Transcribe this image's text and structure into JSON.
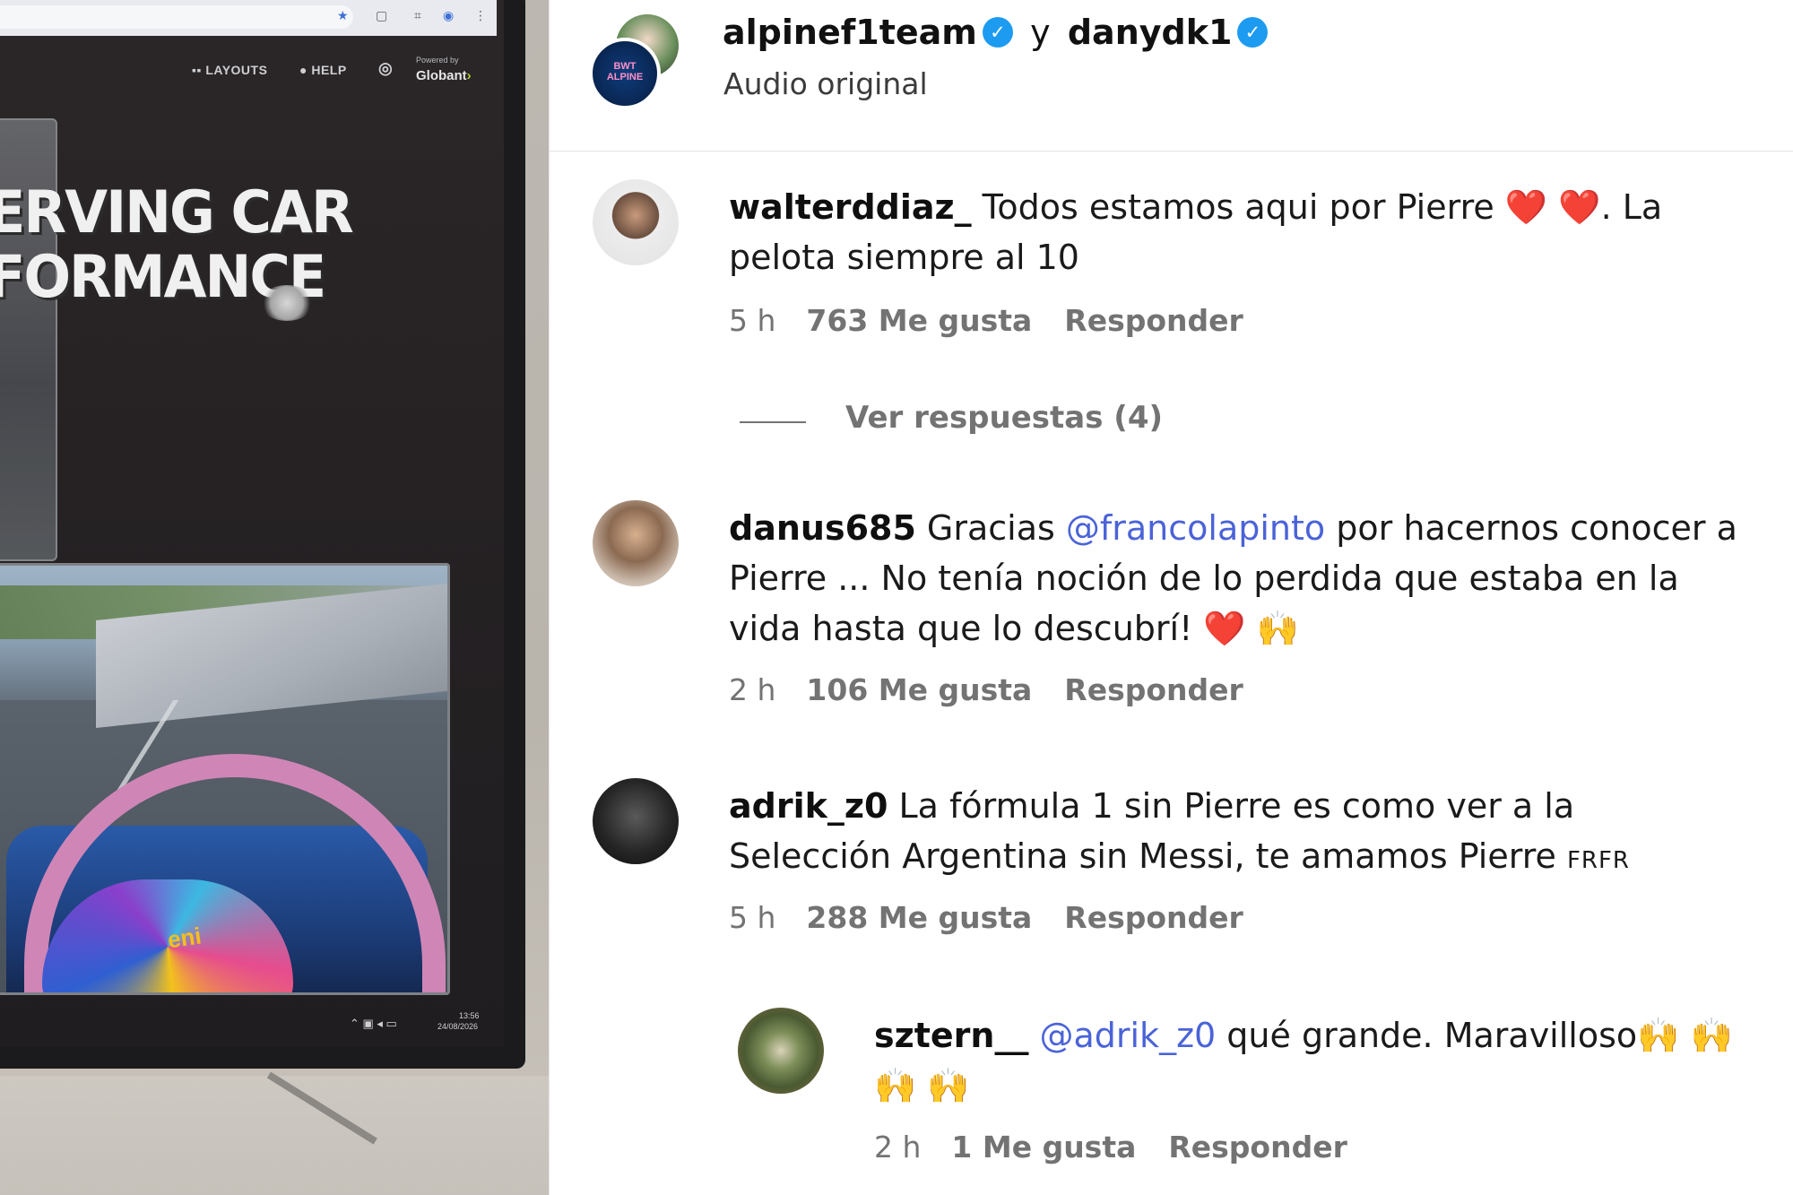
{
  "video": {
    "browser_icons": [
      "star-icon",
      "page-icon",
      "extension-icon",
      "profile-icon",
      "menu-icon"
    ],
    "nav": {
      "layouts": "LAYOUTS",
      "help": "HELP",
      "powered_by": "Powered by",
      "brand": "Globant"
    },
    "headline_line1": "ERVING CAR",
    "headline_line2": "FORMANCE",
    "onboard_logo": "eni",
    "taskbar_time": "13:56",
    "taskbar_date": "24/08/2026"
  },
  "header": {
    "user1": "alpinef1team",
    "joiner": "y",
    "user2": "danydk1",
    "audio_label": "Audio original"
  },
  "comments": [
    {
      "user": "walterddiaz_",
      "text_before": "Todos estamos aqui por Pierre",
      "text_after": ". La pelota siempre al 10",
      "emoji": "❤️ ❤️",
      "time": "5 h",
      "likes": "763 Me gusta",
      "reply": "Responder"
    },
    {
      "user": "danus685",
      "text_before": "Gracias",
      "mention": "@francolapinto",
      "text_after": "por hacernos conocer a Pierre ... No tenía noción de lo perdida que estaba en la vida hasta que lo descubrí!",
      "emoji_heart": "❤️",
      "emoji_hands": "🙌",
      "time": "2 h",
      "likes": "106 Me gusta",
      "reply": "Responder"
    },
    {
      "user": "adrik_z0",
      "text": "La fórmula 1 sin Pierre es como ver a la Selección Argentina sin Messi, te amamos Pierre",
      "suffix": "FRFR",
      "time": "5 h",
      "likes": "288 Me gusta",
      "reply": "Responder"
    },
    {
      "user": "sztern__",
      "mention": "@adrik_z0",
      "text": "qué grande. Maravilloso",
      "emoji": "🙌 🙌 🙌 🙌",
      "time": "2 h",
      "likes": "1 Me gusta",
      "reply": "Responder"
    }
  ],
  "view_replies": "Ver respuestas (4)",
  "colors": {
    "mention": "#4b63d8",
    "meta_gray": "#737373",
    "verified_blue": "#1d9bf0"
  }
}
